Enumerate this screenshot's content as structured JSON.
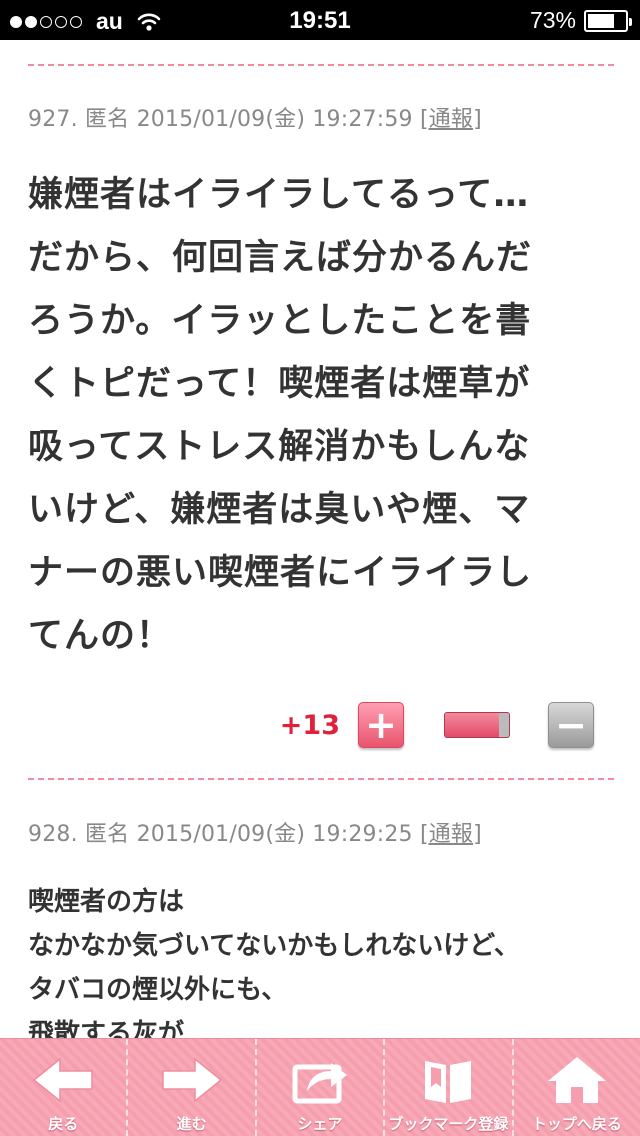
{
  "status_bar": {
    "carrier": "au",
    "time": "19:51",
    "battery_percent": "73%",
    "battery_level": 0.73,
    "signal_bars": 2
  },
  "comments": [
    {
      "meta_prefix": "927. 匿名 2015/01/09(金) 19:27:59 ",
      "report_label": "[通報]",
      "lines": [
        "嫌煙者はイライラしてるって…",
        "だから、何回言えば分かるんだ",
        "ろうか。イラッとしたことを書",
        "くトピだって！喫煙者は煙草が",
        "吸ってストレス解消かもしんな",
        "いけど、嫌煙者は臭いや煙、マ",
        "ナーの悪い喫煙者にイライラし",
        "てんの！"
      ],
      "score": "+13",
      "plus_ratio": 0.85
    },
    {
      "meta_prefix": "928. 匿名 2015/01/09(金) 19:29:25 ",
      "report_label": "[通報]",
      "lines": [
        "喫煙者の方は",
        "なかなか気づいてないかもしれないけど、",
        "タバコの煙以外にも、",
        "飛散する灰が"
      ]
    }
  ],
  "toolbar": {
    "back": "戻る",
    "forward": "進む",
    "share": "シェア",
    "bookmark": "ブックマーク登録",
    "top": "トップへ戻る"
  },
  "colors": {
    "accent_pink": "#f08ca0",
    "score_red": "#e0213b",
    "toolbar_pink": "#f7a9b7"
  }
}
